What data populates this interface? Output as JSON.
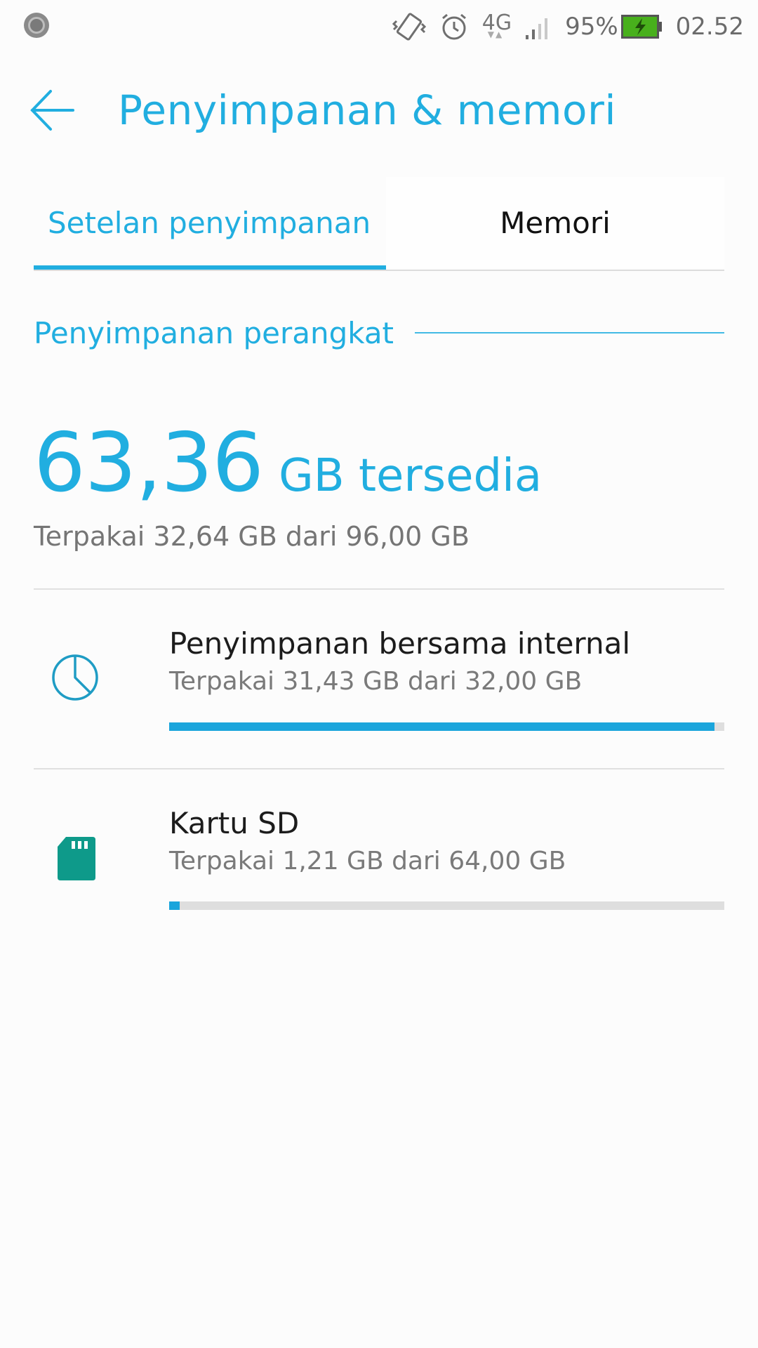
{
  "status_bar": {
    "notification_icon": "circle-notification-icon",
    "vibrate_icon": "vibrate-icon",
    "alarm_icon": "alarm-clock-icon",
    "network_type": "4G",
    "signal_icon": "signal-strength-icon",
    "battery_percent": "95%",
    "battery_icon": "battery-charging-icon",
    "time": "02.52"
  },
  "header": {
    "back_icon": "back-arrow-icon",
    "title": "Penyimpanan & memori"
  },
  "tabs": [
    {
      "label": "Setelan penyimpanan",
      "active": true
    },
    {
      "label": "Memori",
      "active": false
    }
  ],
  "section": {
    "title": "Penyimpanan perangkat"
  },
  "summary": {
    "free_value": "63,36",
    "free_unit": "GB tersedia",
    "used_total": "Terpakai 32,64 GB dari 96,00 GB"
  },
  "volumes": [
    {
      "icon": "pie-chart-icon",
      "name": "Penyimpanan bersama internal",
      "usage": "Terpakai 31,43 GB dari 32,00 GB",
      "used_fraction": 0.982
    },
    {
      "icon": "sd-card-icon",
      "name": "Kartu SD",
      "usage": "Terpakai 1,21 GB dari 64,00 GB",
      "used_fraction": 0.0189
    }
  ],
  "colors": {
    "accent": "#21aee0",
    "bar_fill": "#1aa5dc",
    "bar_track": "#dedede",
    "sd_icon": "#0e9a8a"
  }
}
